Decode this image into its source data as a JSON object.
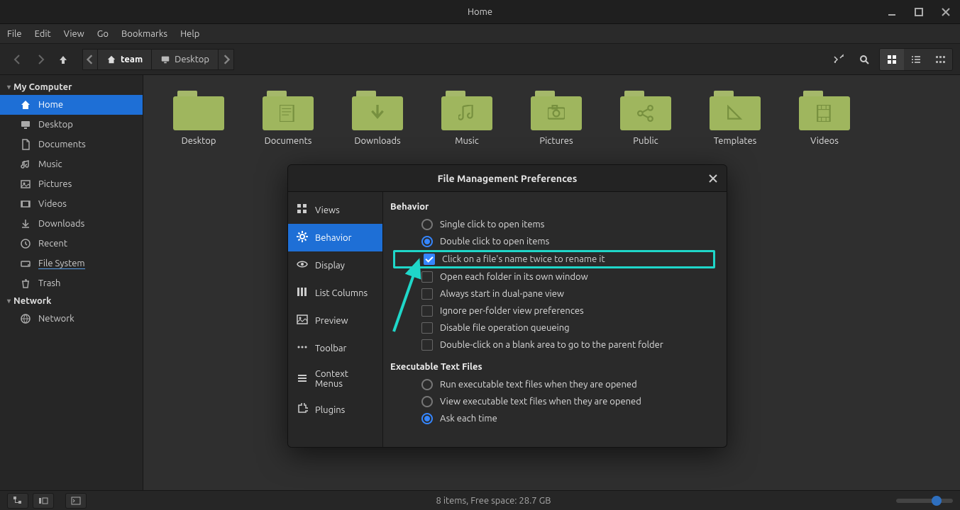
{
  "window": {
    "title": "Home",
    "minimize": "−",
    "maximize": "□",
    "close": "×"
  },
  "menubar": [
    "File",
    "Edit",
    "View",
    "Go",
    "Bookmarks",
    "Help"
  ],
  "toolbar": {
    "crumbs": [
      {
        "label": "team",
        "icon": "home"
      },
      {
        "label": "Desktop",
        "icon": "desktop"
      }
    ]
  },
  "sidebar": {
    "sections": [
      {
        "label": "My Computer",
        "items": [
          {
            "label": "Home",
            "icon": "home",
            "active": true
          },
          {
            "label": "Desktop",
            "icon": "desktop"
          },
          {
            "label": "Documents",
            "icon": "doc"
          },
          {
            "label": "Music",
            "icon": "music"
          },
          {
            "label": "Pictures",
            "icon": "pic"
          },
          {
            "label": "Videos",
            "icon": "video"
          },
          {
            "label": "Downloads",
            "icon": "down"
          },
          {
            "label": "Recent",
            "icon": "recent"
          },
          {
            "label": "File System",
            "icon": "disk",
            "underline": true
          },
          {
            "label": "Trash",
            "icon": "trash"
          }
        ]
      },
      {
        "label": "Network",
        "items": [
          {
            "label": "Network",
            "icon": "net"
          }
        ]
      }
    ]
  },
  "folders": [
    {
      "label": "Desktop",
      "glyph": ""
    },
    {
      "label": "Documents",
      "glyph": "doc"
    },
    {
      "label": "Downloads",
      "glyph": "down"
    },
    {
      "label": "Music",
      "glyph": "music"
    },
    {
      "label": "Pictures",
      "glyph": "cam"
    },
    {
      "label": "Public",
      "glyph": "share"
    },
    {
      "label": "Templates",
      "glyph": "tri"
    },
    {
      "label": "Videos",
      "glyph": "film"
    }
  ],
  "statusbar": {
    "text": "8 items, Free space: 28.7 GB"
  },
  "dialog": {
    "title": "File Management Preferences",
    "nav": [
      {
        "label": "Views",
        "icon": "grid"
      },
      {
        "label": "Behavior",
        "icon": "gear",
        "active": true
      },
      {
        "label": "Display",
        "icon": "eye"
      },
      {
        "label": "List Columns",
        "icon": "cols"
      },
      {
        "label": "Preview",
        "icon": "img"
      },
      {
        "label": "Toolbar",
        "icon": "dots"
      },
      {
        "label": "Context Menus",
        "icon": "menu"
      },
      {
        "label": "Plugins",
        "icon": "puzzle"
      }
    ],
    "behavior": {
      "header": "Behavior",
      "options": {
        "single_click": "Single click to open items",
        "double_click": "Double click to open items",
        "rename_twice": "Click on a file's name twice to rename it",
        "own_window": "Open each folder in its own window",
        "dual_pane": "Always start in dual-pane view",
        "ignore_pref": "Ignore per-folder view preferences",
        "disable_queue": "Disable file operation queueing",
        "dbl_blank": "Double-click on a blank area to go to the parent folder"
      }
    },
    "exec": {
      "header": "Executable Text Files",
      "run": "Run executable text files when they are opened",
      "view": "View executable text files when they are opened",
      "ask": "Ask each time"
    }
  }
}
